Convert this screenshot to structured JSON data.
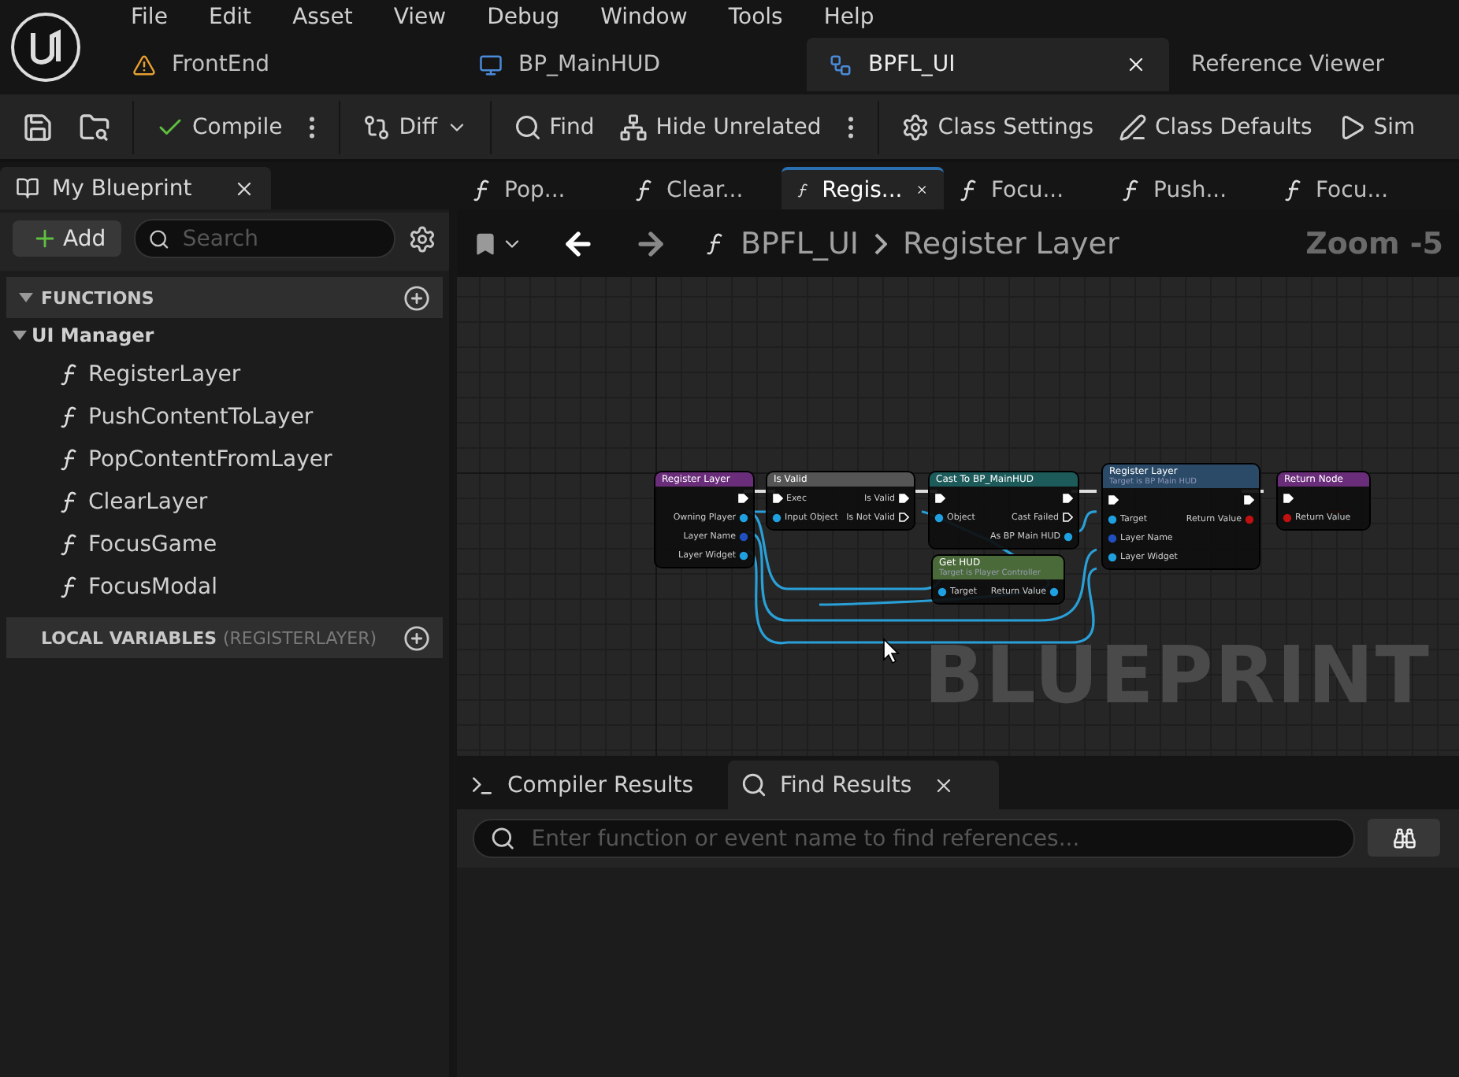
{
  "menu": [
    "File",
    "Edit",
    "Asset",
    "View",
    "Debug",
    "Window",
    "Tools",
    "Help"
  ],
  "document_tabs": [
    {
      "label": "FrontEnd",
      "kind": "level",
      "selected": false
    },
    {
      "label": "BP_MainHUD",
      "kind": "widget",
      "selected": false
    },
    {
      "label": "BPFL_UI",
      "kind": "library",
      "selected": true
    },
    {
      "label": "Reference Viewer",
      "kind": "plain",
      "selected": false
    }
  ],
  "toolbar": [
    {
      "kind": "save"
    },
    {
      "kind": "browse"
    },
    {
      "kind": "compile",
      "label": "Compile",
      "more": true
    },
    {
      "kind": "diff",
      "label": "Diff",
      "dropdown": true
    },
    {
      "kind": "find",
      "label": "Find"
    },
    {
      "kind": "hide",
      "label": "Hide Unrelated",
      "more": true
    },
    {
      "kind": "settings",
      "label": "Class Settings"
    },
    {
      "kind": "defaults",
      "label": "Class Defaults"
    },
    {
      "kind": "simulate",
      "label": "Sim"
    }
  ],
  "my_blueprint": {
    "tab": "My Blueprint",
    "add_button": "Add",
    "search": {
      "placeholder": "Search"
    },
    "sections": [
      {
        "title": "FUNCTIONS",
        "expanded": true,
        "categories": [
          {
            "name": "UI Manager",
            "expanded": true,
            "children": [
              {
                "name": "RegisterLayer"
              },
              {
                "name": "PushContentToLayer"
              },
              {
                "name": "PopContentFromLayer"
              },
              {
                "name": "ClearLayer"
              },
              {
                "name": "FocusGame"
              },
              {
                "name": "FocusModal"
              }
            ]
          }
        ]
      },
      {
        "title": "LOCAL VARIABLES",
        "suffix": "(REGISTERLAYER)",
        "expanded": false
      }
    ]
  },
  "graph_tabs": [
    {
      "label": "Pop...",
      "selected": false
    },
    {
      "label": "Clear...",
      "selected": false
    },
    {
      "label": "Regis...",
      "selected": true
    },
    {
      "label": "Focu...",
      "selected": false
    },
    {
      "label": "Push...",
      "selected": false
    },
    {
      "label": "Focu...",
      "selected": false
    }
  ],
  "breadcrumb": [
    "BPFL_UI",
    "Register Layer"
  ],
  "zoom": "Zoom -5",
  "graph": {
    "watermark": "BLUEPRINT",
    "nodes": [
      {
        "kind": "entry",
        "title": "Register Layer",
        "outputs": [
          {
            "kind": "exec"
          },
          {
            "kind": "object",
            "label": "Owning Player"
          },
          {
            "kind": "name",
            "label": "Layer Name"
          },
          {
            "kind": "object",
            "label": "Layer Widget"
          }
        ]
      },
      {
        "kind": "pure",
        "title": "Is Valid",
        "inputs": [
          {
            "kind": "exec",
            "label": "Exec"
          },
          {
            "kind": "object",
            "label": "Input Object"
          }
        ],
        "outputs": [
          {
            "kind": "exec",
            "label": "Is Valid"
          },
          {
            "kind": "exec_empty",
            "label": "Is Not Valid"
          }
        ]
      },
      {
        "kind": "cast",
        "title": "Cast To BP_MainHUD",
        "inputs": [
          {
            "kind": "exec"
          },
          {
            "kind": "object",
            "label": "Object"
          }
        ],
        "outputs": [
          {
            "kind": "exec"
          },
          {
            "kind": "exec_empty",
            "label": "Cast Failed"
          },
          {
            "kind": "object",
            "label": "As BP Main HUD"
          }
        ]
      },
      {
        "kind": "getter",
        "title": "Get HUD",
        "subtitle": "Target is Player Controller",
        "inputs": [
          {
            "kind": "object",
            "label": "Target"
          }
        ],
        "outputs": [
          {
            "kind": "object",
            "label": "Return Value"
          }
        ]
      },
      {
        "kind": "call",
        "title": "Register Layer",
        "subtitle": "Target is BP Main HUD",
        "inputs": [
          {
            "kind": "exec"
          },
          {
            "kind": "object",
            "label": "Target"
          },
          {
            "kind": "name",
            "label": "Layer Name"
          },
          {
            "kind": "object",
            "label": "Layer Widget"
          }
        ],
        "outputs": [
          {
            "kind": "exec"
          },
          {
            "kind": "bool",
            "label": "Return Value"
          }
        ]
      },
      {
        "kind": "entry",
        "title": "Return Node",
        "inputs": [
          {
            "kind": "exec"
          },
          {
            "kind": "bool",
            "label": "Return Value"
          }
        ]
      }
    ]
  },
  "results_tabs": [
    {
      "kind": "compiler",
      "label": "Compiler Results",
      "selected": false
    },
    {
      "kind": "find",
      "label": "Find Results",
      "selected": true
    }
  ],
  "find": {
    "placeholder": "Enter function or event name to find references..."
  }
}
